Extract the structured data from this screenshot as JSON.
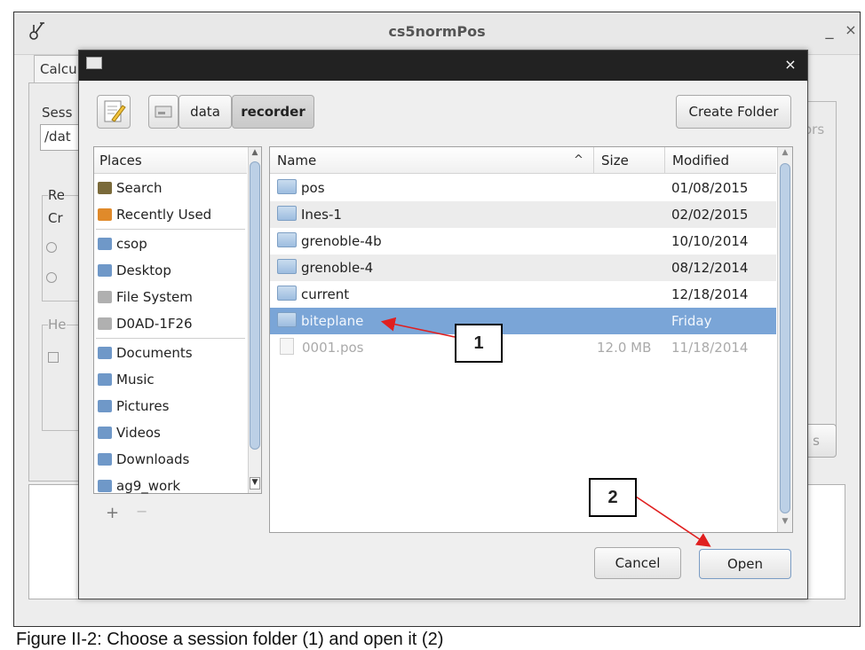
{
  "app": {
    "title": "cs5normPos",
    "minimize": "_",
    "close": "×",
    "tab_label": "Calcu",
    "session_label": "Sess",
    "session_path": "/dat",
    "group_label": "Re",
    "group_sub": "Cr",
    "group2_label": "He",
    "right_tab": "ors",
    "right_btn": "s"
  },
  "dialog": {
    "close": "×",
    "breadcrumbs": [
      "data",
      "recorder"
    ],
    "create_folder": "Create Folder",
    "places_header": "Places",
    "places": [
      {
        "label": "Search",
        "icon": "binoculars-icon",
        "color": "#7a6a3a"
      },
      {
        "label": "Recently Used",
        "icon": "clock-icon",
        "color": "#e08a2a"
      },
      {
        "label": "csop",
        "icon": "home-folder-icon",
        "color": "#6f98c8"
      },
      {
        "label": "Desktop",
        "icon": "desktop-folder-icon",
        "color": "#6f98c8"
      },
      {
        "label": "File System",
        "icon": "drive-icon",
        "color": "#b0b0b0"
      },
      {
        "label": "D0AD-1F26",
        "icon": "drive-icon",
        "color": "#b0b0b0"
      },
      {
        "label": "Documents",
        "icon": "documents-folder-icon",
        "color": "#6f98c8"
      },
      {
        "label": "Music",
        "icon": "music-folder-icon",
        "color": "#6f98c8"
      },
      {
        "label": "Pictures",
        "icon": "pictures-folder-icon",
        "color": "#6f98c8"
      },
      {
        "label": "Videos",
        "icon": "videos-folder-icon",
        "color": "#6f98c8"
      },
      {
        "label": "Downloads",
        "icon": "downloads-folder-icon",
        "color": "#6f98c8"
      },
      {
        "label": "ag9_work",
        "icon": "folder-icon",
        "color": "#6f98c8"
      }
    ],
    "add_place": "+",
    "remove_place": "−",
    "columns": {
      "name": "Name",
      "sort": "^",
      "size": "Size",
      "modified": "Modified"
    },
    "files": [
      {
        "name": "pos",
        "size": "",
        "modified": "01/08/2015",
        "type": "folder"
      },
      {
        "name": "Ines-1",
        "size": "",
        "modified": "02/02/2015",
        "type": "folder"
      },
      {
        "name": "grenoble-4b",
        "size": "",
        "modified": "10/10/2014",
        "type": "folder"
      },
      {
        "name": "grenoble-4",
        "size": "",
        "modified": "08/12/2014",
        "type": "folder"
      },
      {
        "name": "current",
        "size": "",
        "modified": "12/18/2014",
        "type": "folder"
      },
      {
        "name": "biteplane",
        "size": "",
        "modified": "Friday",
        "type": "folder",
        "selected": true
      },
      {
        "name": "0001.pos",
        "size": "12.0 MB",
        "modified": "11/18/2014",
        "type": "file",
        "dim": true
      }
    ],
    "cancel": "Cancel",
    "open": "Open",
    "selection_color": "#7aa5d7"
  },
  "annotations": {
    "callout1": "1",
    "callout2": "2",
    "arrow_color": "#e02020"
  },
  "caption": "Figure II-2: Choose a session folder (1) and open it (2)"
}
